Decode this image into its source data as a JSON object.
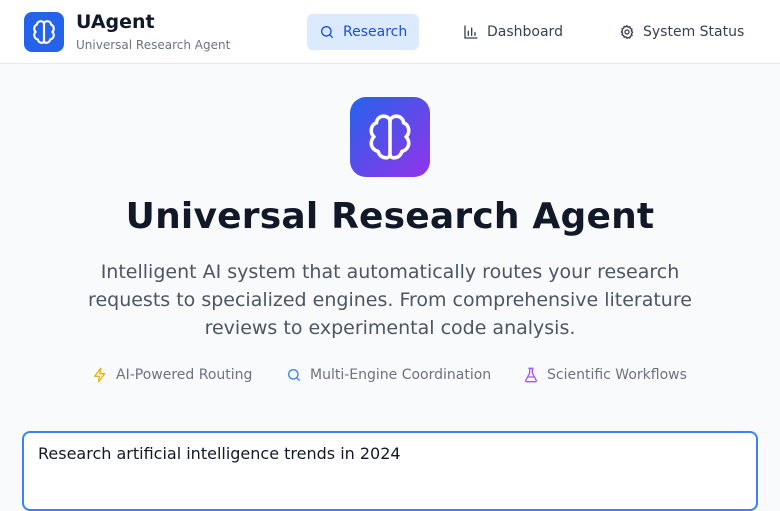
{
  "brand": {
    "name": "UAgent",
    "subtitle": "Universal Research Agent"
  },
  "nav": [
    {
      "label": "Research",
      "icon": "search-icon",
      "active": true
    },
    {
      "label": "Dashboard",
      "icon": "bar-chart-icon",
      "active": false
    },
    {
      "label": "System Status",
      "icon": "gear-icon",
      "active": false
    }
  ],
  "hero": {
    "icon": "brain-icon",
    "title": "Universal Research Agent",
    "description": "Intelligent AI system that automatically routes your research requests to specialized engines. From comprehensive literature reviews to experimental code analysis."
  },
  "features": [
    {
      "label": "AI-Powered Routing",
      "icon": "lightning-icon",
      "color": "#eab308"
    },
    {
      "label": "Multi-Engine Coordination",
      "icon": "search-icon",
      "color": "#3b82f6"
    },
    {
      "label": "Scientific Workflows",
      "icon": "flask-icon",
      "color": "#a855f7"
    }
  ],
  "query_input": {
    "value": "Research artificial intelligence trends in 2024"
  },
  "colors": {
    "primary": "#2563eb",
    "accent": "#9333ea",
    "active_nav_bg": "#dbeafe"
  }
}
